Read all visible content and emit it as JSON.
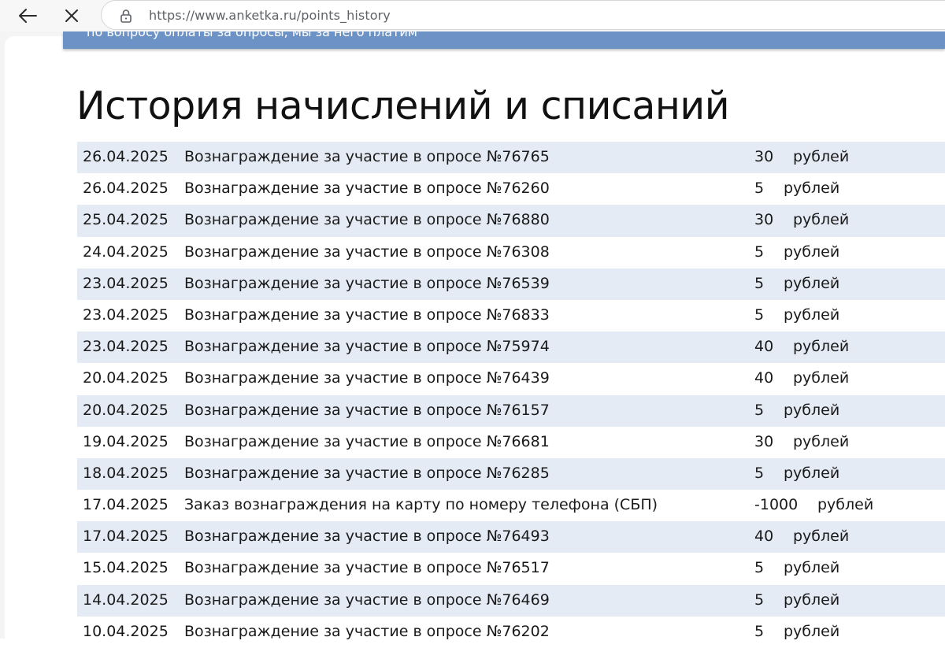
{
  "browser": {
    "url": "https://www.anketka.ru/points_history",
    "back_icon": "arrow-left-icon",
    "close_icon": "close-icon",
    "lock_icon": "lock-icon"
  },
  "banner": {
    "text": "по вопросу оплаты за опросы, мы за него платим"
  },
  "page": {
    "title": "История начислений и списаний"
  },
  "history": [
    {
      "date": "26.04.2025",
      "description": "Вознаграждение за участие в опросе №76765",
      "amount": "30",
      "currency": "рублей"
    },
    {
      "date": "26.04.2025",
      "description": "Вознаграждение за участие в опросе №76260",
      "amount": "5",
      "currency": "рублей"
    },
    {
      "date": "25.04.2025",
      "description": "Вознаграждение за участие в опросе №76880",
      "amount": "30",
      "currency": "рублей"
    },
    {
      "date": "24.04.2025",
      "description": "Вознаграждение за участие в опросе №76308",
      "amount": "5",
      "currency": "рублей"
    },
    {
      "date": "23.04.2025",
      "description": "Вознаграждение за участие в опросе №76539",
      "amount": "5",
      "currency": "рублей"
    },
    {
      "date": "23.04.2025",
      "description": "Вознаграждение за участие в опросе №76833",
      "amount": "5",
      "currency": "рублей"
    },
    {
      "date": "23.04.2025",
      "description": "Вознаграждение за участие в опросе №75974",
      "amount": "40",
      "currency": "рублей"
    },
    {
      "date": "20.04.2025",
      "description": "Вознаграждение за участие в опросе №76439",
      "amount": "40",
      "currency": "рублей"
    },
    {
      "date": "20.04.2025",
      "description": "Вознаграждение за участие в опросе №76157",
      "amount": "5",
      "currency": "рублей"
    },
    {
      "date": "19.04.2025",
      "description": "Вознаграждение за участие в опросе №76681",
      "amount": "30",
      "currency": "рублей"
    },
    {
      "date": "18.04.2025",
      "description": "Вознаграждение за участие в опросе №76285",
      "amount": "5",
      "currency": "рублей"
    },
    {
      "date": "17.04.2025",
      "description": "Заказ вознаграждения на карту по номеру телефона (СБП)",
      "amount": "-1000",
      "currency": "рублей"
    },
    {
      "date": "17.04.2025",
      "description": "Вознаграждение за участие в опросе №76493",
      "amount": "40",
      "currency": "рублей"
    },
    {
      "date": "15.04.2025",
      "description": "Вознаграждение за участие в опросе №76517",
      "amount": "5",
      "currency": "рублей"
    },
    {
      "date": "14.04.2025",
      "description": "Вознаграждение за участие в опросе №76469",
      "amount": "5",
      "currency": "рублей"
    },
    {
      "date": "10.04.2025",
      "description": "Вознаграждение за участие в опросе №76202",
      "amount": "5",
      "currency": "рублей"
    }
  ]
}
